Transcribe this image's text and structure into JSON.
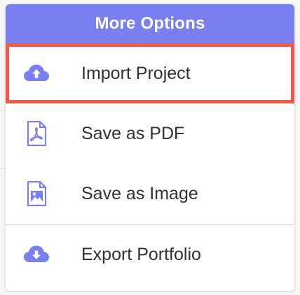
{
  "menu": {
    "title": "More Options",
    "items": [
      {
        "label": "Import Project",
        "icon": "cloud-upload-icon",
        "highlighted": true
      },
      {
        "label": "Save as PDF",
        "icon": "pdf-file-icon",
        "highlighted": false
      },
      {
        "label": "Save as Image",
        "icon": "image-file-icon",
        "highlighted": false
      },
      {
        "label": "Export Portfolio",
        "icon": "cloud-download-icon",
        "highlighted": false
      }
    ]
  },
  "colors": {
    "header_bg": "#7a7ff0",
    "icon": "#7a7ff0",
    "highlight_border": "#ef5a4a",
    "text": "#2f3136"
  }
}
